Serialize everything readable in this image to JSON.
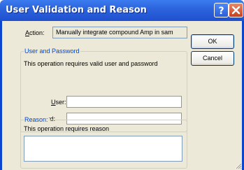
{
  "window": {
    "title": "User Validation and Reason"
  },
  "action": {
    "label": "Action:",
    "value": "Manually integrate compound Amp in sam"
  },
  "buttons": {
    "ok": "OK",
    "cancel": "Cancel"
  },
  "credentials": {
    "group_title": "User and Password",
    "note": "This operation requires valid user and password",
    "user_label_hotkey": "U",
    "user_label_rest": "ser:",
    "user_value": "",
    "password_label": "Password:",
    "password_value": ""
  },
  "reason": {
    "group_title": "Reason:",
    "note": "This operation requires reason",
    "value": ""
  },
  "colors": {
    "titlebar": "#2d64dd",
    "group_title": "#0046d5",
    "dialog_bg": "#ece9d8"
  },
  "icons": {
    "help": "help-icon",
    "close": "close-icon",
    "resize": "resize-grip-icon"
  }
}
